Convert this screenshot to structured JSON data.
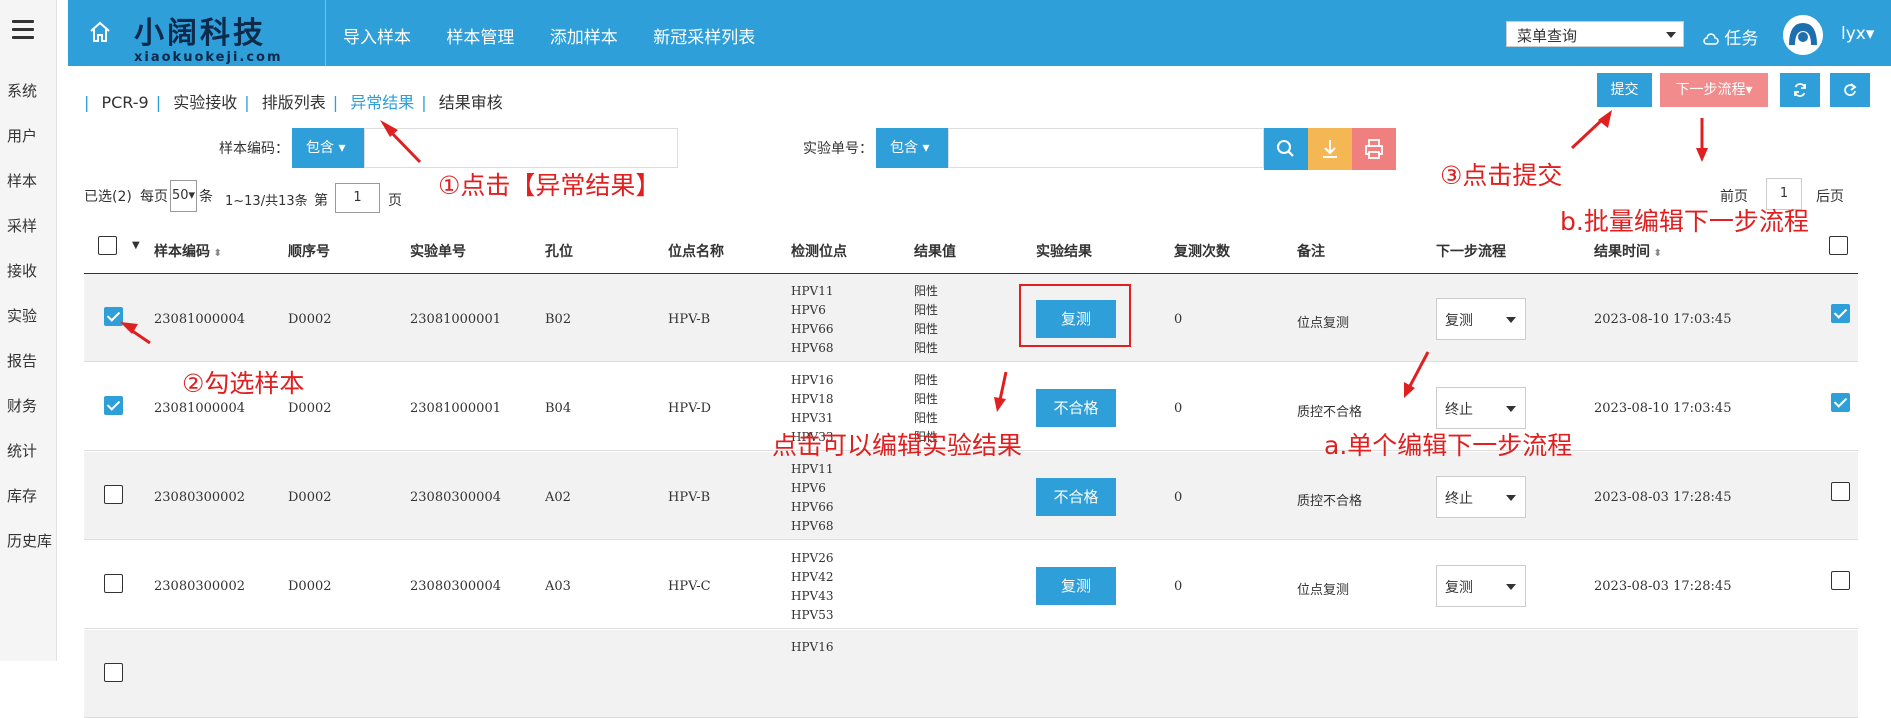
{
  "sidebar": {
    "items": [
      "系统",
      "用户",
      "样本",
      "采样",
      "接收",
      "实验",
      "报告",
      "财务",
      "统计",
      "库存",
      "历史库"
    ]
  },
  "topbar": {
    "logo_main": "小阔科技",
    "logo_sub": "xiaokuokeji.com",
    "nav": [
      "导入样本",
      "样本管理",
      "添加样本",
      "新冠采样列表"
    ],
    "menu_select": "菜单查询",
    "task": "任务",
    "user": "lyx",
    "bg_color": "#2e9fd8"
  },
  "breadcrumb": {
    "items": [
      "PCR-9",
      "实验接收",
      "排版列表",
      "异常结果",
      "结果审核"
    ],
    "active_index": 3
  },
  "toolbar": {
    "submit": "提交",
    "next_flow": "下一步流程",
    "refresh_icon": "refresh-icon",
    "redo_icon": "redo-icon"
  },
  "filters": {
    "sample_code_label": "样本编码：",
    "sample_code_mode": "包含",
    "exp_no_label": "实验单号：",
    "exp_no_mode": "包含"
  },
  "pagination": {
    "selected": "已选(2)",
    "per_page_prefix": "每页",
    "per_page_value": "50",
    "per_page_suffix": "条",
    "range": "1~13/共13条",
    "page_prefix": "第",
    "page_value": "1",
    "page_suffix": "页",
    "prev": "前页",
    "current": "1",
    "next": "后页"
  },
  "table": {
    "headers": [
      "样本编码",
      "顺序号",
      "实验单号",
      "孔位",
      "位点名称",
      "检测位点",
      "结果值",
      "实验结果",
      "复测次数",
      "备注",
      "下一步流程",
      "结果时间"
    ],
    "rows": [
      {
        "code": "23081000004",
        "seq": "D0002",
        "exp": "23081000001",
        "well": "B02",
        "site": "HPV-B",
        "loci": [
          "HPV11",
          "HPV6",
          "HPV66",
          "HPV68"
        ],
        "values": [
          "阳性",
          "阳性",
          "阳性",
          "阳性"
        ],
        "result": "复测",
        "retest": "0",
        "note": "位点复测",
        "next": "复测",
        "time": "2023-08-10 17:03:45",
        "checked": true
      },
      {
        "code": "23081000004",
        "seq": "D0002",
        "exp": "23081000001",
        "well": "B04",
        "site": "HPV-D",
        "loci": [
          "HPV16",
          "HPV18",
          "HPV31",
          "HPV33"
        ],
        "values": [
          "阳性",
          "阳性",
          "阳性",
          "阳性"
        ],
        "result": "不合格",
        "retest": "0",
        "note": "质控不合格",
        "next": "终止",
        "time": "2023-08-10 17:03:45",
        "checked": true
      },
      {
        "code": "23080300002",
        "seq": "D0002",
        "exp": "23080300004",
        "well": "A02",
        "site": "HPV-B",
        "loci": [
          "HPV11",
          "HPV6",
          "HPV66",
          "HPV68"
        ],
        "values": [],
        "result": "不合格",
        "retest": "0",
        "note": "质控不合格",
        "next": "终止",
        "time": "2023-08-03 17:28:45",
        "checked": false
      },
      {
        "code": "23080300002",
        "seq": "D0002",
        "exp": "23080300004",
        "well": "A03",
        "site": "HPV-C",
        "loci": [
          "HPV26",
          "HPV42",
          "HPV43",
          "HPV53"
        ],
        "values": [],
        "result": "复测",
        "retest": "0",
        "note": "位点复测",
        "next": "复测",
        "time": "2023-08-03 17:28:45",
        "checked": false
      },
      {
        "code": "",
        "seq": "",
        "exp": "",
        "well": "",
        "site": "",
        "loci": [
          "HPV16"
        ],
        "values": [],
        "result": "",
        "retest": "",
        "note": "",
        "next": "",
        "time": "",
        "checked": false
      }
    ]
  },
  "annotations": {
    "a1": "①点击【异常结果】",
    "a2": "②勾选样本",
    "a3": "③点击提交",
    "a4": "b.批量编辑下一步流程",
    "a5": "点击可以编辑实验结果",
    "a6": "a.单个编辑下一步流程",
    "color": "#e02020"
  }
}
